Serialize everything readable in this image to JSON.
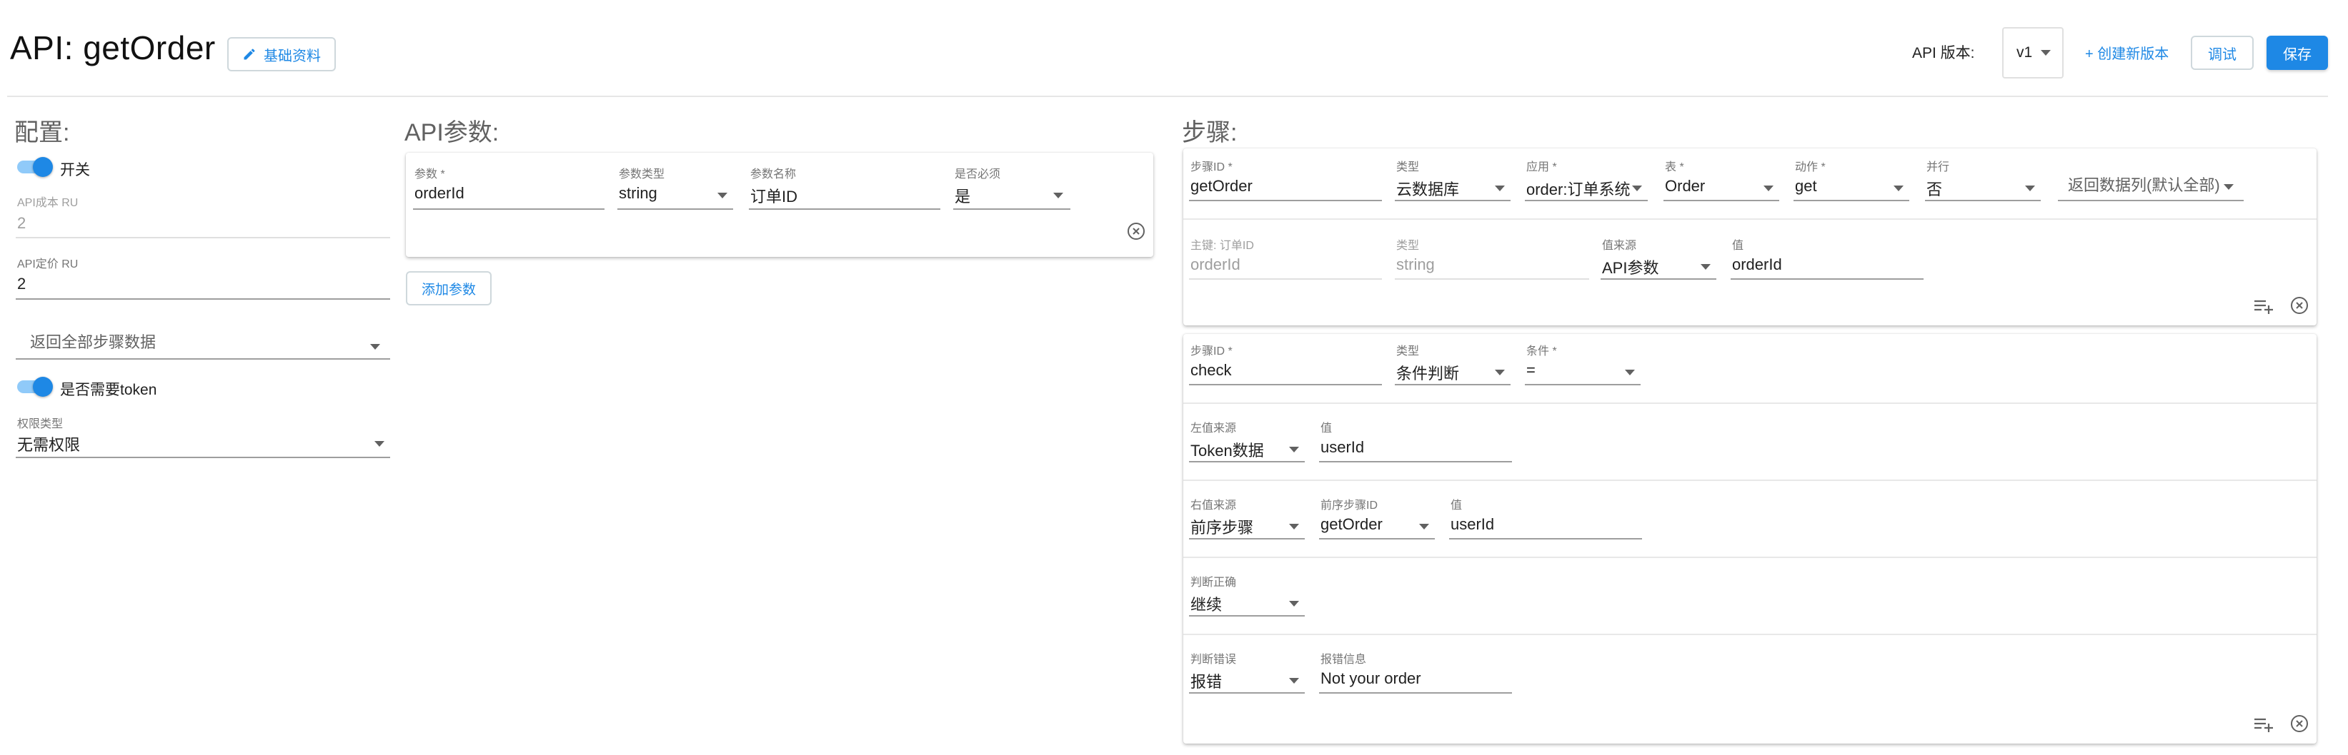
{
  "header": {
    "title": "API: getOrder",
    "basic_info_label": "基础资料",
    "version_label": "API 版本:",
    "version_value": "v1",
    "create_version_label": "+ 创建新版本",
    "debug_label": "调试",
    "save_label": "保存"
  },
  "colors": {
    "accent": "#1e88e5",
    "toggle_track": "#90caf9"
  },
  "config": {
    "title": "配置:",
    "switch_label": "开关",
    "cost_label": "API成本 RU",
    "cost_value": "2",
    "price_label": "API定价 RU",
    "price_value": "2",
    "return_select": "返回全部步骤数据",
    "token_label": "是否需要token",
    "permission_label": "权限类型",
    "permission_value": "无需权限"
  },
  "params": {
    "title": "API参数:",
    "items": [
      {
        "param_label": "参数",
        "param_value": "orderId",
        "type_label": "参数类型",
        "type_value": "string",
        "name_label": "参数名称",
        "name_value": "订单ID",
        "required_label": "是否必须",
        "required_value": "是"
      }
    ],
    "add_label": "添加参数"
  },
  "steps": {
    "title": "步骤:",
    "step1": {
      "id_label": "步骤ID",
      "id_value": "getOrder",
      "type_label": "类型",
      "type_value": "云数据库",
      "app_label": "应用",
      "app_value": "order:订单系统",
      "table_label": "表",
      "table_value": "Order",
      "action_label": "动作",
      "action_value": "get",
      "parallel_label": "并行",
      "parallel_value": "否",
      "return_cols": "返回数据列(默认全部)",
      "pk_label": "主键: 订单ID",
      "pk_value": "orderId",
      "pk_type_label": "类型",
      "pk_type_value": "string",
      "source_label": "值来源",
      "source_value": "API参数",
      "val_label": "值",
      "val_value": "orderId"
    },
    "step2": {
      "id_label": "步骤ID",
      "id_value": "check",
      "type_label": "类型",
      "type_value": "条件判断",
      "cond_label": "条件",
      "cond_value": "=",
      "left_label": "左值来源",
      "left_value": "Token数据",
      "left_val_label": "值",
      "left_val_value": "userId",
      "right_label": "右值来源",
      "right_value": "前序步骤",
      "prev_label": "前序步骤ID",
      "prev_value": "getOrder",
      "right_val_label": "值",
      "right_val_value": "userId",
      "true_label": "判断正确",
      "true_value": "继续",
      "false_label": "判断错误",
      "false_value": "报错",
      "err_label": "报错信息",
      "err_value": "Not your order"
    }
  }
}
